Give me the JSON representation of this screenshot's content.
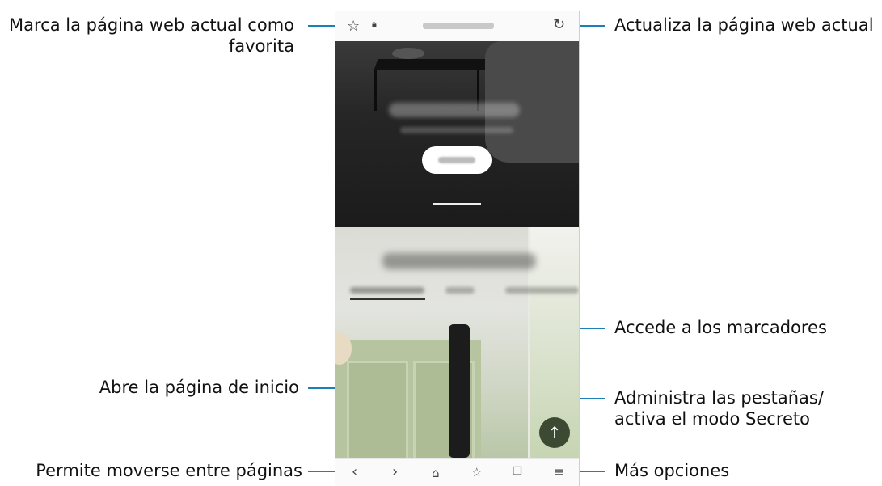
{
  "callouts": {
    "favorite": "Marca la página web actual como\nfavorita",
    "favorite_line1": "Marca la página web actual como",
    "favorite_line2": "favorita",
    "refresh": "Actualiza la página web actual",
    "bookmarks": "Accede a los marcadores",
    "home": "Abre la página de inicio",
    "tabs_line1": "Administra las pestañas/",
    "tabs_line2": "activa el modo Secreto",
    "navigate": "Permite moverse entre páginas",
    "more": "Más opciones"
  },
  "icons": {
    "favorite": "star-outline-icon",
    "lock": "lock-icon",
    "refresh": "refresh-icon",
    "back": "chevron-left-icon",
    "forward": "chevron-right-icon",
    "home": "home-icon",
    "bookmarks": "star-list-icon",
    "tabs": "tabs-icon",
    "more": "menu-icon",
    "scroll_top": "arrow-up-icon"
  },
  "colors": {
    "callout_line": "#1e7fb8"
  }
}
